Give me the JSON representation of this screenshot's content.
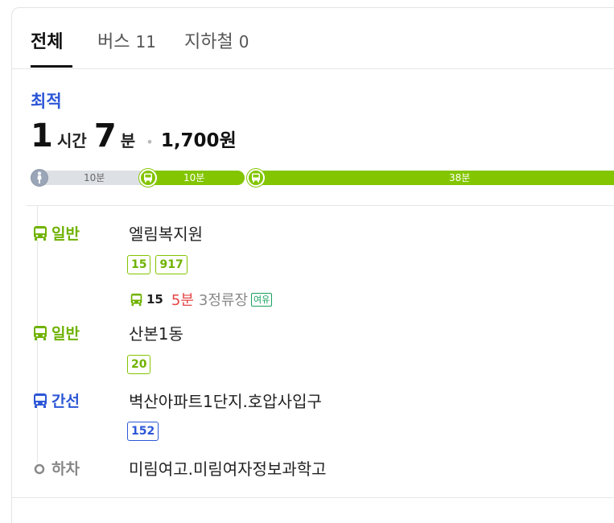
{
  "tabs": [
    {
      "label": "전체",
      "count": ""
    },
    {
      "label": "버스",
      "count": "11"
    },
    {
      "label": "지하철",
      "count": "0"
    }
  ],
  "best_label": "최적",
  "summary": {
    "hours": "1",
    "hours_unit": "시간",
    "minutes": "7",
    "minutes_unit": "분",
    "fare": "1,700원"
  },
  "progress": {
    "segments": [
      {
        "mode": "walk",
        "label": "10분"
      },
      {
        "mode": "bus",
        "label": "10분"
      },
      {
        "mode": "bus",
        "label": "38분"
      }
    ]
  },
  "steps": [
    {
      "type": "일반",
      "type_color": "#6fb200",
      "stop": "엘림복지원",
      "routes": [
        "15",
        "917"
      ]
    },
    {
      "type": "일반",
      "type_color": "#6fb200",
      "stop": "산본1동",
      "routes": [
        "20"
      ]
    },
    {
      "type": "간선",
      "type_color": "#2c56d6",
      "stop": "벽산아파트1단지.호압사입구",
      "routes": [
        "152"
      ]
    },
    {
      "type": "하차",
      "type_color": "#888888",
      "stop": "미림여고.미림여자정보과학고",
      "routes": []
    }
  ],
  "arrival": {
    "route": "15",
    "minutes": "5분",
    "stops": "3정류장",
    "crowd": "여유"
  },
  "colors": {
    "accent_blue": "#2c56d6",
    "bus_green": "#83c500",
    "arrival_red": "#e54545",
    "crowd_green": "#17a05d"
  },
  "icons": {
    "walk": "walking-person-icon",
    "bus": "bus-icon",
    "alight": "circle-icon"
  }
}
